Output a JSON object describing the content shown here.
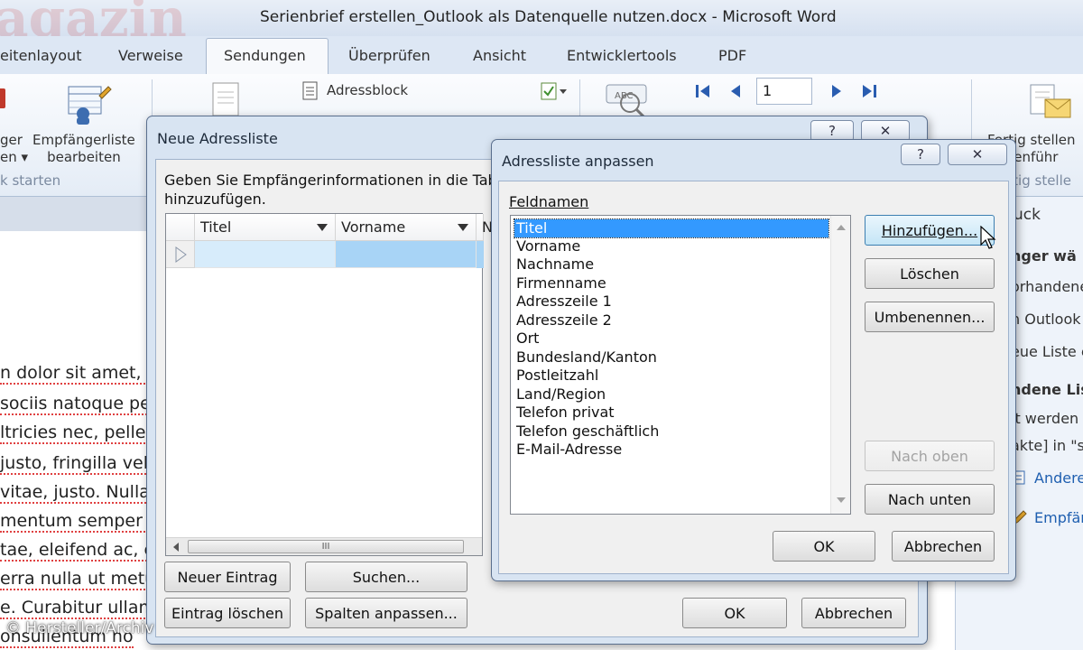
{
  "window": {
    "title": "Serienbrief erstellen_Outlook als Datenquelle nutzen.docx - Microsoft Word",
    "watermark_partial": "agazin"
  },
  "ribbon_tabs": [
    "eitenlayout",
    "Verweise",
    "Sendungen",
    "Überprüfen",
    "Ansicht",
    "Entwicklertools",
    "PDF"
  ],
  "active_tab": "Sendungen",
  "ribbon": {
    "btn_partial_line1": "ger",
    "btn_partial_line2": "en",
    "empf_line1": "Empfängerliste",
    "empf_line2": "bearbeiten",
    "group_start": "k starten",
    "adressblock": "Adressblock",
    "record_number": "1",
    "fertig_line1": "Fertig stellen",
    "fertig_line2": "mmenführ",
    "group_fertig": "rtig stelle"
  },
  "document_lines": [
    "n dolor sit amet, co",
    "sociis natoque pe",
    "ltricies nec, peller",
    "justo, fringilla vel,",
    "vitae, justo. Nulla",
    "mentum semper n",
    "tae, eleifend ac, e",
    "erra nulla ut metu",
    "e. Curabitur ullam",
    "onsullentum ho"
  ],
  "side_pane": {
    "header": "ruck",
    "line1": "nger wä",
    "line2": "orhandene",
    "line3": "n Outlook",
    "line4": "eue Liste e",
    "line5": "ndene Lis",
    "line6": "it werden",
    "line7": "akte] in \"s",
    "link1": "Andere",
    "link2": "Empfän"
  },
  "neue_adressliste": {
    "title": "Neue Adressliste",
    "help_glyph": "?",
    "close_glyph": "✕",
    "instruction_line1": "Geben Sie Empfängerinformationen in die Tabelle",
    "instruction_line2": "hinzuzufügen.",
    "columns": [
      "Titel",
      "Vorname",
      "N"
    ],
    "hscroll_glyph": "III",
    "btn_new": "Neuer Eintrag",
    "btn_search": "Suchen...",
    "btn_delete": "Eintrag löschen",
    "btn_columns": "Spalten anpassen...",
    "btn_ok": "OK",
    "btn_cancel": "Abbrechen"
  },
  "adressliste_anpassen": {
    "title": "Adressliste anpassen",
    "help_glyph": "?",
    "close_glyph": "✕",
    "field_label": "Feldnamen",
    "fields": [
      "Titel",
      "Vorname",
      "Nachname",
      "Firmenname",
      "Adresszeile 1",
      "Adresszeile 2",
      "Ort",
      "Bundesland/Kanton",
      "Postleitzahl",
      "Land/Region",
      "Telefon privat",
      "Telefon geschäftlich",
      "E-Mail-Adresse"
    ],
    "selected_field": "Titel",
    "btn_add": "Hinzufügen...",
    "btn_delete": "Löschen",
    "btn_rename": "Umbenennen...",
    "btn_up": "Nach oben",
    "btn_down": "Nach unten",
    "btn_ok": "OK",
    "btn_cancel": "Abbrechen"
  },
  "copyright": "© Hersteller/Archiv"
}
